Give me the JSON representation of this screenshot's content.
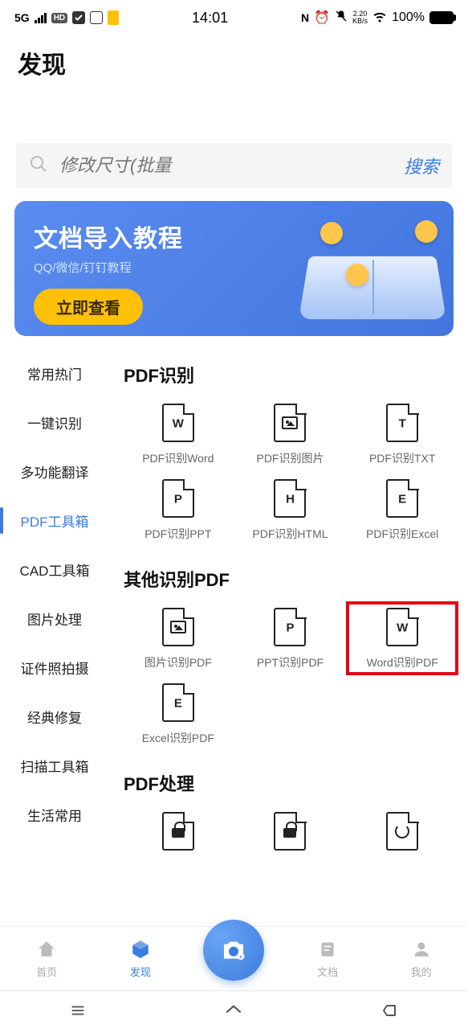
{
  "status": {
    "network": "5G",
    "hd": "HD",
    "time": "14:01",
    "speed_top": "2.20",
    "speed_unit": "KB/s",
    "battery_pct": "100%"
  },
  "page_title": "发现",
  "search": {
    "placeholder": "修改尺寸(批量",
    "button": "搜索"
  },
  "banner": {
    "title": "文档导入教程",
    "sub": "QQ/微信/钉钉教程",
    "cta": "立即查看"
  },
  "sidebar": {
    "items": [
      {
        "label": "常用热门"
      },
      {
        "label": "一键识别"
      },
      {
        "label": "多功能翻译"
      },
      {
        "label": "PDF工具箱",
        "active": true
      },
      {
        "label": "CAD工具箱"
      },
      {
        "label": "图片处理"
      },
      {
        "label": "证件照拍摄"
      },
      {
        "label": "经典修复"
      },
      {
        "label": "扫描工具箱"
      },
      {
        "label": "生活常用"
      }
    ]
  },
  "sections": [
    {
      "title": "PDF识别",
      "tools": [
        {
          "label": "PDF识别Word",
          "glyph": "W"
        },
        {
          "label": "PDF识别图片",
          "glyph": "img"
        },
        {
          "label": "PDF识别TXT",
          "glyph": "T"
        },
        {
          "label": "PDF识别PPT",
          "glyph": "P"
        },
        {
          "label": "PDF识别HTML",
          "glyph": "H"
        },
        {
          "label": "PDF识别Excel",
          "glyph": "E"
        }
      ]
    },
    {
      "title": "其他识别PDF",
      "tools": [
        {
          "label": "图片识别PDF",
          "glyph": "img"
        },
        {
          "label": "PPT识别PDF",
          "glyph": "P"
        },
        {
          "label": "Word识别PDF",
          "glyph": "W",
          "highlighted": true
        },
        {
          "label": "Excel识别PDF",
          "glyph": "E"
        }
      ]
    },
    {
      "title": "PDF处理",
      "tools": [
        {
          "label": "",
          "glyph": "lock"
        },
        {
          "label": "",
          "glyph": "lock"
        },
        {
          "label": "",
          "glyph": "refresh"
        }
      ]
    }
  ],
  "bottom_nav": {
    "items": [
      {
        "label": "首页"
      },
      {
        "label": "发现",
        "active": true
      },
      {
        "label": ""
      },
      {
        "label": "文档"
      },
      {
        "label": "我的"
      }
    ]
  }
}
